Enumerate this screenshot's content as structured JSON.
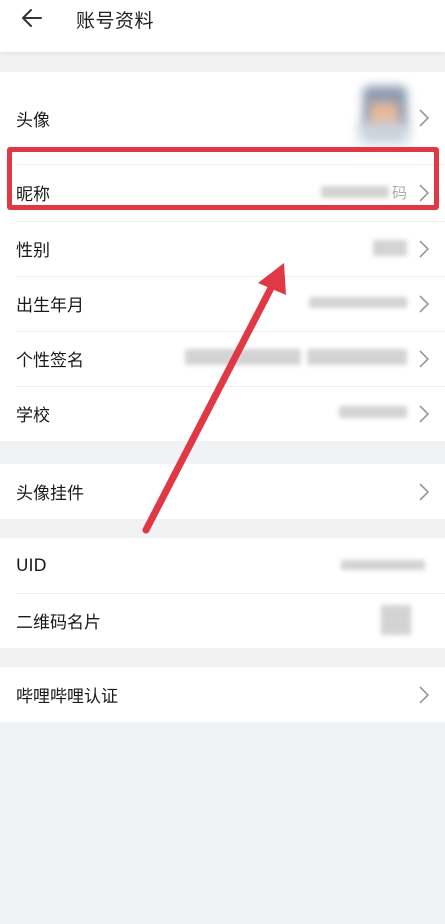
{
  "header": {
    "title": "账号资料",
    "back_icon": "arrow-left-icon"
  },
  "groups": [
    {
      "items": [
        {
          "label": "头像",
          "value_type": "avatar"
        },
        {
          "label": "昵称",
          "value_type": "blurred-text",
          "visible_suffix": "码"
        },
        {
          "label": "性别",
          "value_type": "blurred-text"
        },
        {
          "label": "出生年月",
          "value_type": "blurred-text"
        },
        {
          "label": "个性签名",
          "value_type": "blurred-text"
        },
        {
          "label": "学校",
          "value_type": "blurred-text"
        }
      ]
    },
    {
      "items": [
        {
          "label": "头像挂件"
        }
      ]
    },
    {
      "items": [
        {
          "label": "UID",
          "value_type": "blurred-text"
        },
        {
          "label": "二维码名片",
          "value_type": "blurred-image"
        }
      ]
    },
    {
      "items": [
        {
          "label": "哔哩哔哩认证"
        }
      ]
    }
  ],
  "annotation": {
    "highlight_color": "#e03845",
    "highlighted_item": "昵称"
  },
  "colors": {
    "background": "#f1f2f3",
    "card": "#ffffff",
    "text": "#1a1a1a",
    "chevron": "#999999"
  }
}
